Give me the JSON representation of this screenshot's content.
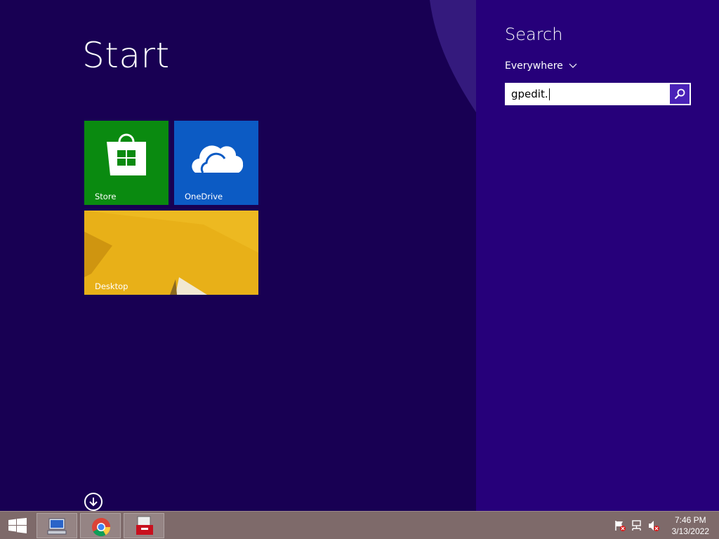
{
  "start": {
    "title": "Start"
  },
  "tiles": {
    "store": {
      "label": "Store",
      "color": "#0a8a10"
    },
    "onedrive": {
      "label": "OneDrive",
      "color": "#0c5bc4"
    },
    "desktop": {
      "label": "Desktop",
      "color": "#e6ac12"
    }
  },
  "search": {
    "title": "Search",
    "scope": "Everywhere",
    "query": "gpedit."
  },
  "taskbar": {
    "apps": [
      "network-computer-icon",
      "chrome-icon",
      "toolbox-icon"
    ]
  },
  "clock": {
    "time": "7:46 PM",
    "date": "3/13/2022"
  },
  "colors": {
    "start_bg": "#180053",
    "search_bg": "#26007a",
    "taskbar": "#7e6a6a"
  }
}
